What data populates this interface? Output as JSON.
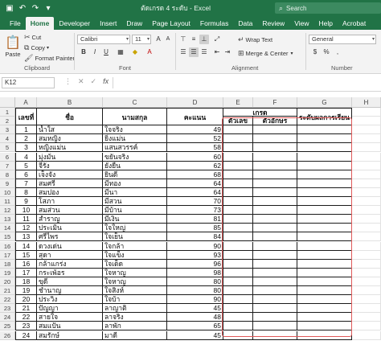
{
  "titlebar": {
    "title": "ตัดเกรด 4 ระดับ  -  Excel",
    "search": "Search"
  },
  "tabs": [
    "File",
    "Home",
    "Developer",
    "Insert",
    "Draw",
    "Page Layout",
    "Formulas",
    "Data",
    "Review",
    "View",
    "Help",
    "Acrobat"
  ],
  "ribbon": {
    "paste": "Paste",
    "cut": "Cut",
    "copy": "Copy",
    "format_painter": "Format Painter",
    "clipboard": "Clipboard",
    "font_name": "Calibri",
    "font_size": "11",
    "bold": "B",
    "italic": "I",
    "underline": "U",
    "font_group": "Font",
    "wrap_text": "Wrap Text",
    "merge_center": "Merge & Center",
    "alignment": "Alignment",
    "number_format": "General",
    "number_group": "Number"
  },
  "formula_bar": {
    "name_box": "K12",
    "fx": "fx"
  },
  "columns": [
    "A",
    "B",
    "C",
    "D",
    "E",
    "F",
    "G",
    "H"
  ],
  "headers": {
    "no": "เลขที่",
    "first": "ชื่อ",
    "last": "นามสกุล",
    "score": "คะแนน",
    "grade": "เกรด",
    "grade_num": "ตัวเลข",
    "grade_letter": "ตัวอักษร",
    "level": "ระดับผลการเรียน"
  },
  "rows": [
    {
      "no": "1",
      "first": "น้ำใส",
      "last": "ใจจริง",
      "score": "49"
    },
    {
      "no": "2",
      "first": "สมหญิง",
      "last": "ยิ่งแม่น",
      "score": "52"
    },
    {
      "no": "3",
      "first": "หญิงแม่น",
      "last": "แสนสวรรค์",
      "score": "58"
    },
    {
      "no": "4",
      "first": "มุ่งมั่น",
      "last": "ขยันจริง",
      "score": "60"
    },
    {
      "no": "5",
      "first": "จีรัง",
      "last": "ยั่งยืน",
      "score": "62"
    },
    {
      "no": "6",
      "first": "เจ็งจัง",
      "last": "ยินดี",
      "score": "68"
    },
    {
      "no": "7",
      "first": "สมศรี",
      "last": "มีทอง",
      "score": "64"
    },
    {
      "no": "8",
      "first": "สมปอง",
      "last": "มีนา",
      "score": "64"
    },
    {
      "no": "9",
      "first": "โสภา",
      "last": "มีสวน",
      "score": "70"
    },
    {
      "no": "10",
      "first": "สมส่วน",
      "last": "มีบ้าน",
      "score": "73"
    },
    {
      "no": "11",
      "first": "สำราญ",
      "last": "มีเงิน",
      "score": "81"
    },
    {
      "no": "12",
      "first": "ประเมิน",
      "last": "ใจใหญ่",
      "score": "85"
    },
    {
      "no": "13",
      "first": "ศรีไพร",
      "last": "ใจเย็น",
      "score": "84"
    },
    {
      "no": "14",
      "first": "ดวงเด่น",
      "last": "ใจกล้า",
      "score": "90"
    },
    {
      "no": "15",
      "first": "สุดา",
      "last": "ใจแข็ง",
      "score": "93"
    },
    {
      "no": "16",
      "first": "กล้าแกร่ง",
      "last": "ใจเด็ด",
      "score": "96"
    },
    {
      "no": "17",
      "first": "กระเพ้อร",
      "last": "ใจหาญ",
      "score": "98"
    },
    {
      "no": "18",
      "first": "ขุดี",
      "last": "ใจหาญ",
      "score": "80"
    },
    {
      "no": "19",
      "first": "ชำนาญ",
      "last": "ใจสิงห์",
      "score": "80"
    },
    {
      "no": "20",
      "first": "ประวิง",
      "last": "ใจบ้า",
      "score": "90"
    },
    {
      "no": "21",
      "first": "ปัญญา",
      "last": "ลาญาติ",
      "score": "45"
    },
    {
      "no": "22",
      "first": "สายใจ",
      "last": "ลาจริง",
      "score": "48"
    },
    {
      "no": "23",
      "first": "สมแป้น",
      "last": "ลาพัก",
      "score": "65"
    },
    {
      "no": "24",
      "first": "สมรักษ์",
      "last": "มาดี",
      "score": "45"
    }
  ]
}
